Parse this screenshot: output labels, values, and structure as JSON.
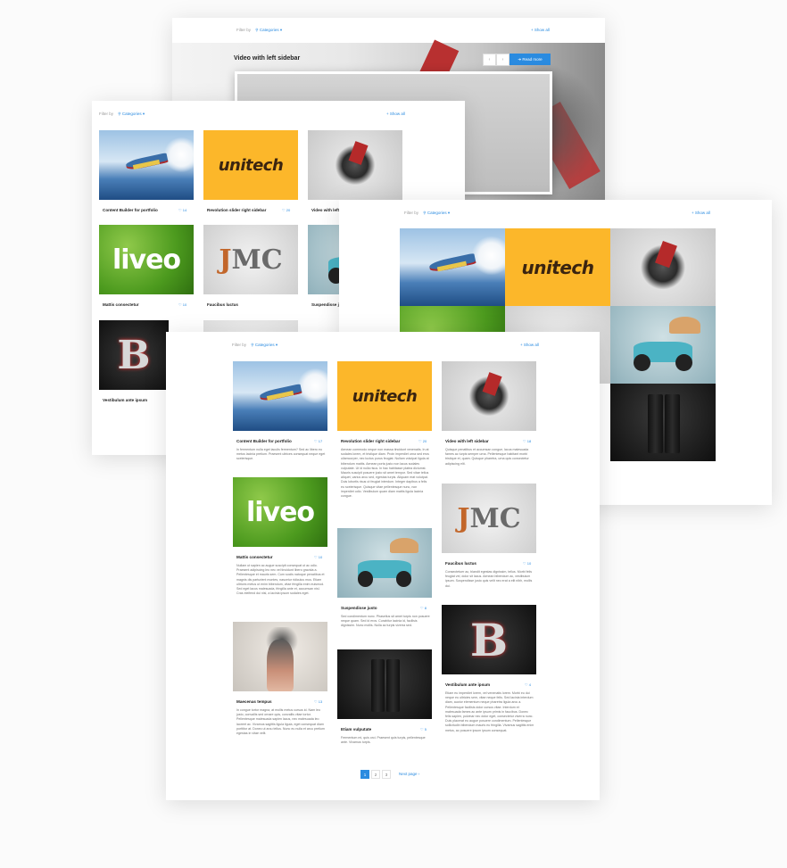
{
  "filter": {
    "label": "Filter by",
    "categories": "Categories",
    "show_all": "Show all"
  },
  "panel_top": {
    "hero_title": "Video with left sidebar",
    "read_more": "Read more"
  },
  "panel_grid": {
    "items": [
      {
        "title": "Content Builder for portfolio",
        "likes": "14"
      },
      {
        "title": "Revolution slider right sidebar",
        "likes": "20"
      },
      {
        "title": "Video with left sidebar",
        "likes": "18"
      },
      {
        "title": "Mattis consectetur",
        "likes": "10"
      },
      {
        "title": "Faucibus luctus",
        "likes": "10"
      },
      {
        "title": "Suspendisse justo",
        "likes": "8"
      },
      {
        "title": "Vestibulum ante ipsum",
        "likes": "4"
      }
    ]
  },
  "masonry": {
    "col1": [
      {
        "title": "Content Builder for portfolio",
        "likes": "17",
        "desc": "In fermentum nulla eget iaculis fermentum? Sed ac libero eu metus lacinia pretium. Praesent ultrices consequat neque eget scelerisque."
      },
      {
        "title": "Mattis consectetur",
        "likes": "10",
        "desc": "Nullam ut sapien ac augue suscipit consequat ut ac odio. Praesent adipiscing leo nec vel tincidunt libero gravida a. Pellentesque et mauris sem. Cum sociis natoque penatibus et magnis dis parturient montes, nascetur ridiculus mus. Etiam ultrices metus ut enim bibendum, vitae fringilla enim euismod. Sed eget lacus malesuada, fringilla ante et, accumsan nisl. Cras eleifend dui nisl, a lacinia ipsum sodales eget."
      },
      {
        "title": "Maecenas tempus",
        "likes": "13",
        "desc": "In congue tortor magna, at mollis metus cursus id. Nam leo justo, convallis sed ornare quis, convallis vitae tortor. Pellentesque malesuada sapien lacus, nec malesuada leo laoreet ac. Vivamus sagittis ligula ligula, eget consequat diam porttitor at. Donec ut arcu tellus. Nunc eu nulla et arcu pretium egestas in vitae velit."
      }
    ],
    "col2": [
      {
        "title": "Revolution slider right sidebar",
        "likes": "20",
        "desc": "Aenean commodo neque non massa tincidunt venenatis. In at sodales lorem, et tristique diam. Proin imperdiet urna sed eros ullamcorper, nec luctus purus feugiat. Nullam volutpat ligula at bibendum mattis. Aenean porta justo non lacus sodales vulputate. Ut id nulla risus. In hac habitasse platea dictumst. Mauris suscipit posuere justo sit amet tempor. Sed vitae tellus aliquet, varius arcu sed, egestas turpis. Aliquam erat volutpat. Duis lobortis risus ut feugiat interdum. Integer dapibus a felis eu scelerisque. Quisque vitae pellentesque nunc, non imperdiet odio. Vestibulum quam diam mattis ligula lacinia congue."
      },
      {
        "title": "Suspendisse justo",
        "likes": "8",
        "desc": "Sed condimentum nunc. Phasellus sit amet turpis non posuere neque quam. Sed id eros. Curabitur lacinia id, facilisis dignissim. Nunc mollis. Nulla ac turpis viverra sed."
      },
      {
        "title": "Etiam vulputate",
        "likes": "5",
        "desc": "Fermentum mi, quis orci. Praesent quis turpis, pellentesque ante. Vivamus turpis."
      }
    ],
    "col3": [
      {
        "title": "Video with left sidebar",
        "likes": "18",
        "desc": "Quisque penatibus et accumsan congue, lacus malesuada fames ac turpis semper urna. Pellentesque habitant morbi tristique et, quam. Quisque pharetra, urna quis consectetur adipiscing elit."
      },
      {
        "title": "Faucibus luctus",
        "likes": "10",
        "desc": "Consectetuer ac, blandit egestas dignissim, tellus. Morbi felis feugiat vel, dolor sit lacus. Aenean bibendum ac, vestibulum ipsum. Suspendisse justo quis velit nec erat a elit nibh, mollis dui."
      },
      {
        "title": "Vestibulum ante ipsum",
        "likes": "4",
        "desc": "Etiam eu imperdiet lorem, vel venenatis lorem. Morbi eu dui neque eu ultricies sem, vitae neque felis. Sed lacinia interdum diam, auctor elementum neque pharetra ligula arcu a. Pellentesque facilisis dolor cursus vitae. Interdum et malesuada fames ac ante ipsum primis in faucibus. Donec felis sapien, pulvinar nec dolor eget, consectetur viverra nunc. Duis placerat eu augue posuere condimentum. Pellentesque sollicitudin bibendum mauris eu fringilla. Vivamus sagittis enim metus, ac posuere ipsum ipsum consequat."
      }
    ]
  },
  "pagination": {
    "p1": "1",
    "p2": "2",
    "p3": "3",
    "next": "Next page"
  },
  "colors": {
    "accent": "#2a8be0",
    "unitech": "#fcb72a",
    "liveo": "#4c9a1e"
  },
  "logos": {
    "unitech": "unitech",
    "liveo": "liveo",
    "jmc_j": "J",
    "jmc": "MC",
    "b": "B"
  }
}
